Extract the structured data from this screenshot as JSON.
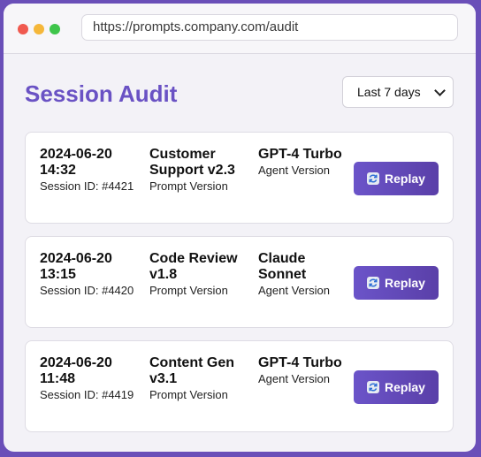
{
  "browser": {
    "url": "https://prompts.company.com/audit"
  },
  "header": {
    "title": "Session Audit",
    "range_selected": "Last 7 days"
  },
  "labels": {
    "prompt_version": "Prompt Version",
    "agent_version": "Agent Version",
    "replay": "Replay"
  },
  "sessions": [
    {
      "timestamp": "2024-06-20 14:32",
      "session_id": "Session ID: #4421",
      "prompt": "Customer Support v2.3",
      "agent": "GPT-4 Turbo"
    },
    {
      "timestamp": "2024-06-20 13:15",
      "session_id": "Session ID: #4420",
      "prompt": "Code Review v1.8",
      "agent": "Claude Sonnet"
    },
    {
      "timestamp": "2024-06-20 11:48",
      "session_id": "Session ID: #4419",
      "prompt": "Content Gen v3.1",
      "agent": "GPT-4 Turbo"
    }
  ],
  "colors": {
    "accent": "#6a52c4",
    "button": "#5a3fa8",
    "frame": "#6a4fb8"
  },
  "icons": {
    "replay": "refresh-icon"
  }
}
